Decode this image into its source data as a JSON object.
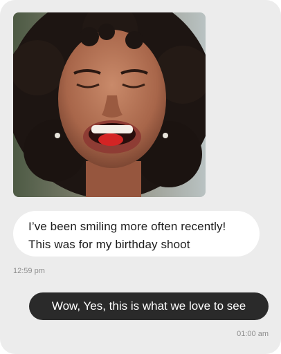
{
  "messages": {
    "photo": {
      "image_name": "smiling-woman-photo"
    },
    "incoming": {
      "lines": [
        "I’ve been smiling more often recently!",
        "This was for my birthday shoot"
      ],
      "time": "12:59 pm"
    },
    "outgoing": {
      "text": "Wow, Yes, this is what we love to see",
      "time": "01:00 am"
    }
  },
  "colors": {
    "background": "#ececec",
    "incoming_bubble": "#ffffff",
    "outgoing_bubble": "#2a2a2a",
    "timestamp": "#8e8e8e"
  }
}
